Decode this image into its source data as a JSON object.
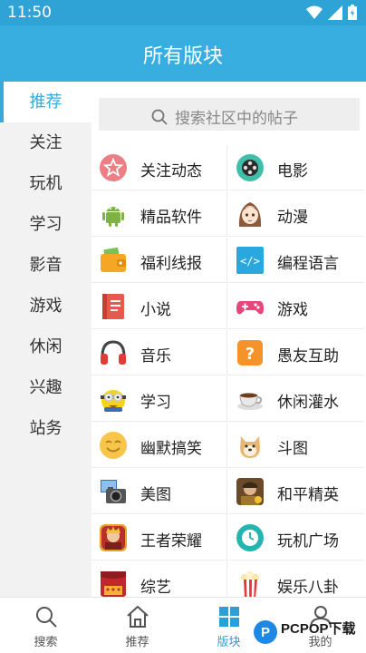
{
  "status_bar": {
    "time": "11:50"
  },
  "header": {
    "title": "所有版块"
  },
  "sidebar": {
    "items": [
      {
        "label": "推荐",
        "active": true
      },
      {
        "label": "关注"
      },
      {
        "label": "玩机"
      },
      {
        "label": "学习"
      },
      {
        "label": "影音"
      },
      {
        "label": "游戏"
      },
      {
        "label": "休闲"
      },
      {
        "label": "兴趣"
      },
      {
        "label": "站务"
      }
    ]
  },
  "search": {
    "placeholder": "搜索社区中的帖子"
  },
  "boards": [
    {
      "label": "关注动态",
      "icon": "star-badge-icon"
    },
    {
      "label": "电影",
      "icon": "film-reel-icon"
    },
    {
      "label": "精品软件",
      "icon": "android-icon"
    },
    {
      "label": "动漫",
      "icon": "anime-girl-icon"
    },
    {
      "label": "福利线报",
      "icon": "wallet-icon"
    },
    {
      "label": "编程语言",
      "icon": "code-icon"
    },
    {
      "label": "小说",
      "icon": "book-icon"
    },
    {
      "label": "游戏",
      "icon": "gamepad-icon"
    },
    {
      "label": "音乐",
      "icon": "headphones-icon"
    },
    {
      "label": "愚友互助",
      "icon": "question-icon"
    },
    {
      "label": "学习",
      "icon": "minion-icon"
    },
    {
      "label": "休闲灌水",
      "icon": "coffee-cup-icon"
    },
    {
      "label": "幽默搞笑",
      "icon": "smiley-icon"
    },
    {
      "label": "斗图",
      "icon": "doge-icon"
    },
    {
      "label": "美图",
      "icon": "camera-icon"
    },
    {
      "label": "和平精英",
      "icon": "game-hero-icon"
    },
    {
      "label": "王者荣耀",
      "icon": "game-king-icon"
    },
    {
      "label": "玩机广场",
      "icon": "clock-icon"
    },
    {
      "label": "综艺",
      "icon": "stage-icon"
    },
    {
      "label": "娱乐八卦",
      "icon": "popcorn-icon"
    }
  ],
  "bottom_nav": [
    {
      "label": "搜索",
      "icon": "search-icon"
    },
    {
      "label": "推荐",
      "icon": "home-icon"
    },
    {
      "label": "版块",
      "icon": "grid-icon",
      "active": true
    },
    {
      "label": "我的",
      "icon": "user-icon"
    }
  ],
  "watermark": {
    "brand": "PCPOP下载"
  },
  "colors": {
    "accent": "#38aee0",
    "active_text": "#3aa7db",
    "sidebar_bg": "#f2f2f2"
  }
}
